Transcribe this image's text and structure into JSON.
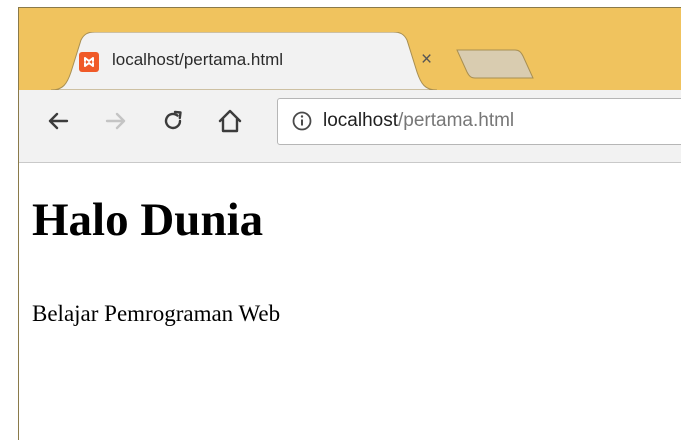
{
  "browser": {
    "tab": {
      "title": "localhost/pertama.html",
      "close_symbol": "×",
      "favicon": "xampp-icon"
    },
    "toolbar": {
      "back_icon": "back-arrow-icon",
      "forward_icon": "forward-arrow-icon",
      "reload_icon": "reload-icon",
      "home_icon": "home-icon"
    },
    "omnibox": {
      "info_icon": "info-icon",
      "host": "localhost",
      "path": "/pertama.html"
    },
    "colors": {
      "frame": "#f0c35e",
      "toolbar": "#f2f2f2",
      "favicon": "#f05a28"
    }
  },
  "page": {
    "heading": "Halo Dunia",
    "paragraph": "Belajar Pemrograman Web"
  }
}
